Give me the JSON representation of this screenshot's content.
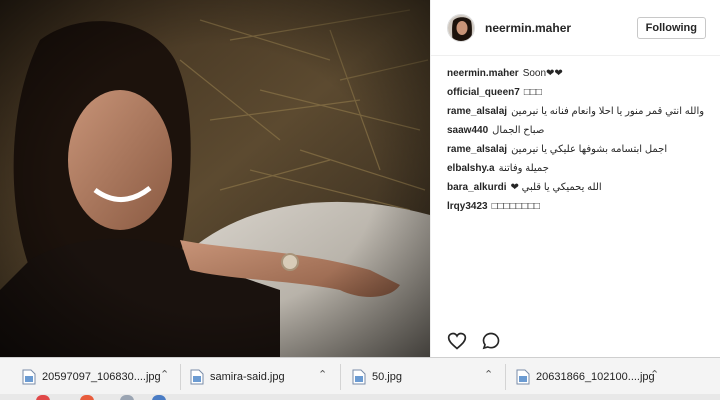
{
  "post": {
    "username": "neermin.maher",
    "follow_label": "Following"
  },
  "comments": [
    {
      "user": "neermin.maher",
      "text": "Soon❤❤",
      "rtl": false
    },
    {
      "user": "official_queen7",
      "text": "□□□",
      "rtl": false
    },
    {
      "user": "rame_alsalaj",
      "text": "والله انتي قمر منور يا احلا وانعام فنانه يا نيرمين",
      "rtl": true
    },
    {
      "user": "saaw440",
      "text": "صباح الجمال",
      "rtl": true
    },
    {
      "user": "rame_alsalaj",
      "text": "اجمل ابتسامه بشوفها عليكي يا نيرمين",
      "rtl": true
    },
    {
      "user": "elbalshy.a",
      "text": "جميلة وفاتنة",
      "rtl": true
    },
    {
      "user": "bara_alkurdi",
      "text": "الله يحميكي يا قلبي ❤",
      "rtl": true
    },
    {
      "user": "lrqy3423",
      "text": "□□□□□□□□",
      "rtl": false
    }
  ],
  "icons": {
    "like": "heart-icon",
    "comment": "comment-icon"
  },
  "downloads": [
    {
      "name": "20597097_106830....jpg"
    },
    {
      "name": "samira-said.jpg"
    },
    {
      "name": "50.jpg"
    },
    {
      "name": "20631866_102100....jpg"
    }
  ],
  "colors": {
    "text": "#262626",
    "border": "#efefef",
    "download_bar": "#f4f4f4"
  }
}
